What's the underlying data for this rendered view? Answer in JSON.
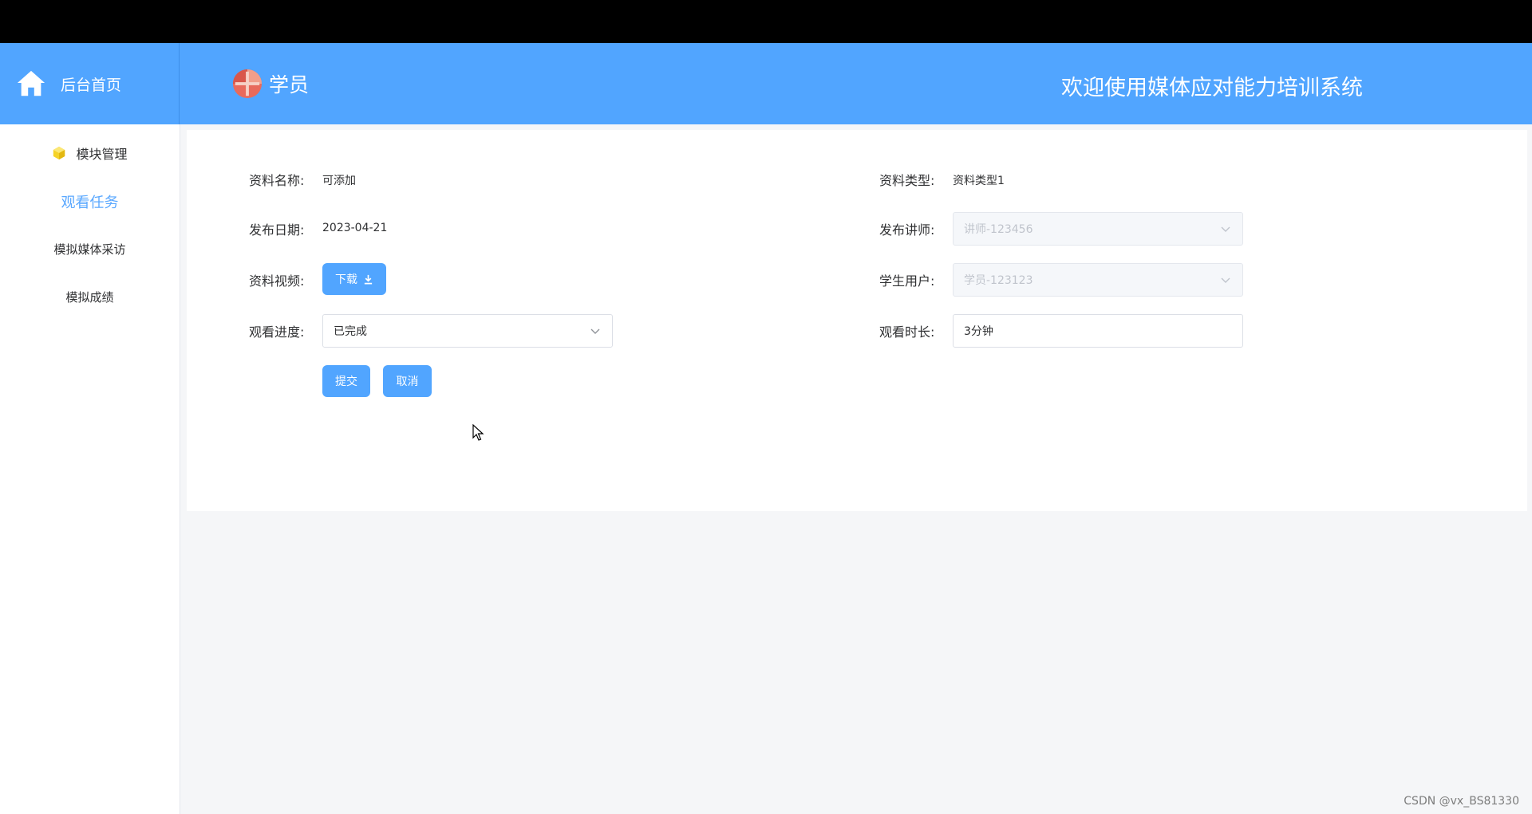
{
  "header": {
    "home_label": "后台首页",
    "role_label": "学员",
    "welcome_text": "欢迎使用媒体应对能力培训系统"
  },
  "sidebar": {
    "items": [
      {
        "label": "模块管理",
        "icon": "cube-icon"
      },
      {
        "label": "观看任务",
        "active": true
      },
      {
        "label": "模拟媒体采访"
      },
      {
        "label": "模拟成绩"
      }
    ]
  },
  "form": {
    "name_label": "资料名称:",
    "name_value": "可添加",
    "type_label": "资料类型:",
    "type_value": "资料类型1",
    "date_label": "发布日期:",
    "date_value": "2023-04-21",
    "teacher_label": "发布讲师:",
    "teacher_placeholder": "讲师-123456",
    "video_label": "资料视频:",
    "download_label": "下载",
    "student_label": "学生用户:",
    "student_placeholder": "学员-123123",
    "progress_label": "观看进度:",
    "progress_value": "已完成",
    "duration_label": "观看时长:",
    "duration_value": "3分钟",
    "submit_label": "提交",
    "cancel_label": "取消"
  },
  "watermark": "CSDN @vx_BS81330",
  "colors": {
    "accent": "#51a5ff",
    "active_nav": "#5aa8ff",
    "page_bg": "#f5f6f8"
  }
}
